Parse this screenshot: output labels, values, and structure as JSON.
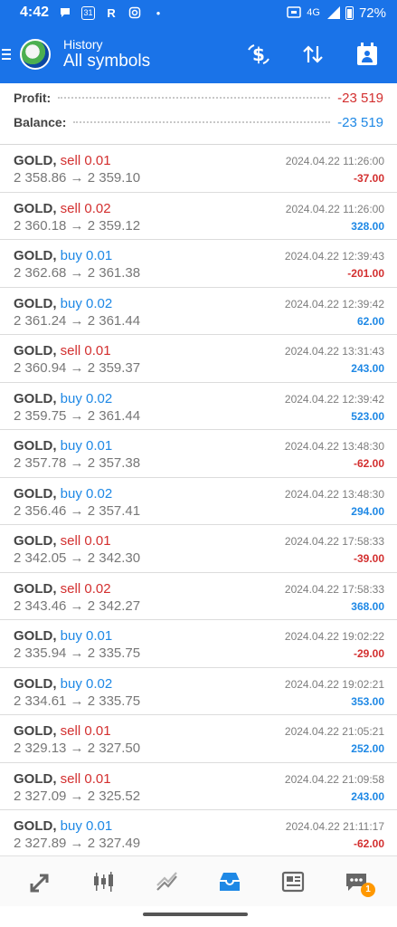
{
  "status_bar": {
    "time": "4:42",
    "calendar_day": "31",
    "r_label": "R",
    "network": "4G",
    "battery": "72%"
  },
  "header": {
    "title": "History",
    "subtitle": "All symbols"
  },
  "summary": {
    "profit_label": "Profit:",
    "profit_value": "-23 519",
    "balance_label": "Balance:",
    "balance_value": "-23 519"
  },
  "colors": {
    "accent": "#1a73e8",
    "loss": "#d32f2f",
    "gain": "#1e88e5"
  },
  "deals": [
    {
      "symbol": "GOLD,",
      "action": "sell 0.01",
      "prices": "2 358.86 → 2 359.10",
      "datetime": "2024.04.22 11:26:00",
      "pl": "-37.00"
    },
    {
      "symbol": "GOLD,",
      "action": "sell 0.02",
      "prices": "2 360.18 → 2 359.12",
      "datetime": "2024.04.22 11:26:00",
      "pl": "328.00"
    },
    {
      "symbol": "GOLD,",
      "action": "buy 0.01",
      "prices": "2 362.68 → 2 361.38",
      "datetime": "2024.04.22 12:39:43",
      "pl": "-201.00"
    },
    {
      "symbol": "GOLD,",
      "action": "buy 0.02",
      "prices": "2 361.24 → 2 361.44",
      "datetime": "2024.04.22 12:39:42",
      "pl": "62.00"
    },
    {
      "symbol": "GOLD,",
      "action": "sell 0.01",
      "prices": "2 360.94 → 2 359.37",
      "datetime": "2024.04.22 13:31:43",
      "pl": "243.00"
    },
    {
      "symbol": "GOLD,",
      "action": "buy 0.02",
      "prices": "2 359.75 → 2 361.44",
      "datetime": "2024.04.22 12:39:42",
      "pl": "523.00"
    },
    {
      "symbol": "GOLD,",
      "action": "buy 0.01",
      "prices": "2 357.78 → 2 357.38",
      "datetime": "2024.04.22 13:48:30",
      "pl": "-62.00"
    },
    {
      "symbol": "GOLD,",
      "action": "buy 0.02",
      "prices": "2 356.46 → 2 357.41",
      "datetime": "2024.04.22 13:48:30",
      "pl": "294.00"
    },
    {
      "symbol": "GOLD,",
      "action": "sell 0.01",
      "prices": "2 342.05 → 2 342.30",
      "datetime": "2024.04.22 17:58:33",
      "pl": "-39.00"
    },
    {
      "symbol": "GOLD,",
      "action": "sell 0.02",
      "prices": "2 343.46 → 2 342.27",
      "datetime": "2024.04.22 17:58:33",
      "pl": "368.00"
    },
    {
      "symbol": "GOLD,",
      "action": "buy 0.01",
      "prices": "2 335.94 → 2 335.75",
      "datetime": "2024.04.22 19:02:22",
      "pl": "-29.00"
    },
    {
      "symbol": "GOLD,",
      "action": "buy 0.02",
      "prices": "2 334.61 → 2 335.75",
      "datetime": "2024.04.22 19:02:21",
      "pl": "353.00"
    },
    {
      "symbol": "GOLD,",
      "action": "sell 0.01",
      "prices": "2 329.13 → 2 327.50",
      "datetime": "2024.04.22 21:05:21",
      "pl": "252.00"
    },
    {
      "symbol": "GOLD,",
      "action": "sell 0.01",
      "prices": "2 327.09 → 2 325.52",
      "datetime": "2024.04.22 21:09:58",
      "pl": "243.00"
    },
    {
      "symbol": "GOLD,",
      "action": "buy 0.01",
      "prices": "2 327.89 → 2 327.49",
      "datetime": "2024.04.22 21:11:17",
      "pl": "-62.00"
    }
  ],
  "nav": {
    "items": [
      "quotes-icon",
      "chart-icon",
      "trade-icon",
      "history-icon",
      "news-icon",
      "messages-icon"
    ],
    "badge": "1"
  }
}
